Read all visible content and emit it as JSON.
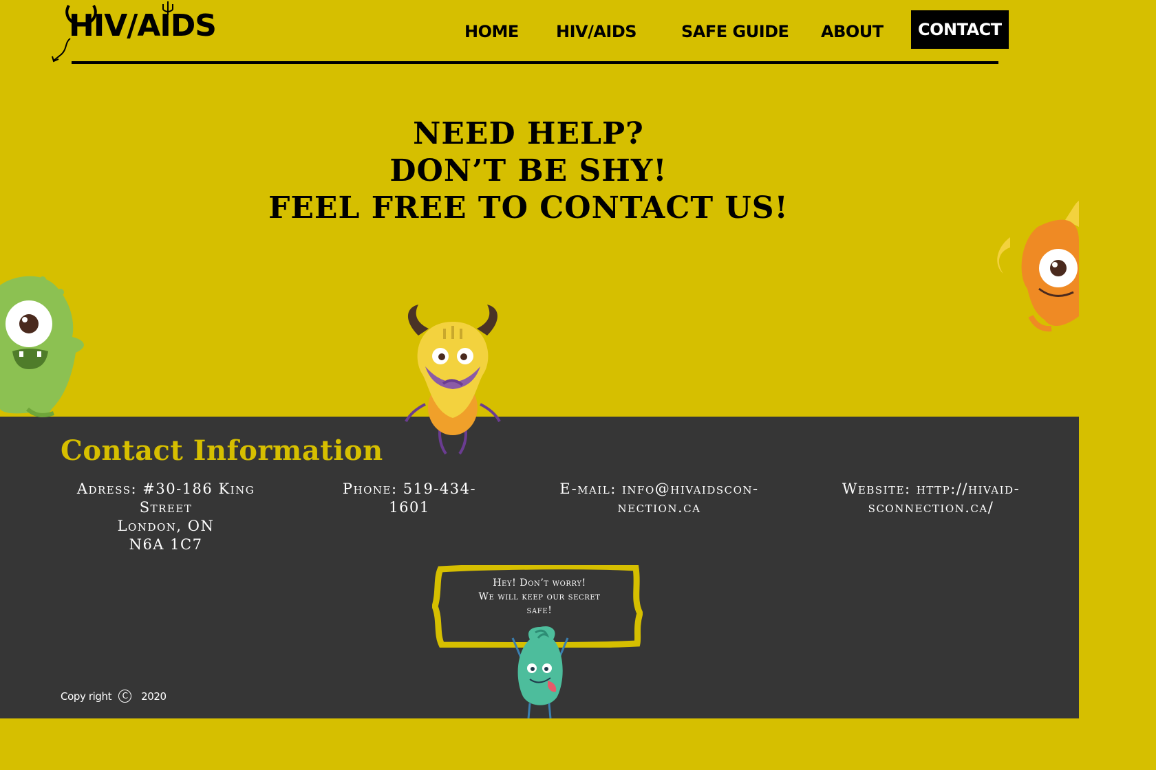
{
  "logo": {
    "text": "HIV/AIDS"
  },
  "nav": {
    "items": [
      {
        "label": "HOME",
        "active": false
      },
      {
        "label": "HIV/AIDS",
        "active": false
      },
      {
        "label": "SAFE GUIDE",
        "active": false
      },
      {
        "label": "ABOUT",
        "active": false
      },
      {
        "label": "CONTACT",
        "active": true
      }
    ]
  },
  "hero": {
    "lines": [
      "NEED HELP?",
      "DON’T BE SHY!",
      "FEEL FREE TO CONTACT US!"
    ]
  },
  "contact": {
    "title": "Contact Information",
    "address": {
      "line1": "Adress: #30-186 King Street",
      "line2": "London, ON",
      "line3": "N6A 1C7"
    },
    "phone": "Phone: 519-434-1601",
    "email": {
      "line1": "E-mail: info@hivaidscon-",
      "line2": "nection.ca"
    },
    "website": {
      "line1": "Website: http://hivaid-",
      "line2": "sconnection.ca/"
    }
  },
  "bubble": {
    "line1": "Hey! Don’t worry!",
    "line2": "We will keep our secret",
    "line3": "safe!"
  },
  "footer": {
    "copyright_label": "Copy right",
    "copyright_symbol": "C",
    "year": "2020"
  },
  "colors": {
    "brand_yellow": "#d6bf00",
    "footer_dark": "#363636",
    "text_dark": "#000000",
    "text_light": "#ffffff"
  }
}
